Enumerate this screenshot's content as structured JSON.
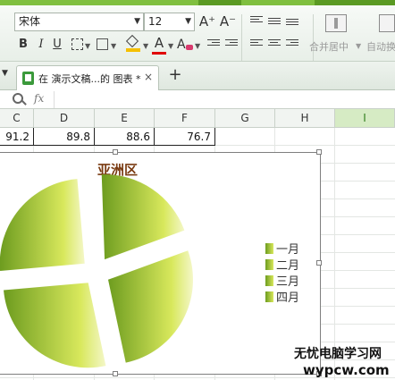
{
  "ribbon": {
    "font_name": "宋体",
    "font_size": "12",
    "bold_label": "B",
    "italic_label": "I",
    "underline_label": "U",
    "grow_font_label": "A⁺",
    "shrink_font_label": "A⁻",
    "font_color_label": "A",
    "merge_center_label": "合并居中",
    "auto_wrap_label": "自动换"
  },
  "tabs": [
    {
      "title": "在 演示文稿...的 图表 *",
      "close": "×"
    }
  ],
  "tab_add_label": "+",
  "formula_bar": {
    "fx_label": "fx",
    "value": ""
  },
  "columns": [
    {
      "label": "C",
      "selected": false
    },
    {
      "label": "D",
      "selected": false
    },
    {
      "label": "E",
      "selected": false
    },
    {
      "label": "F",
      "selected": false
    },
    {
      "label": "G",
      "selected": false
    },
    {
      "label": "H",
      "selected": false
    },
    {
      "label": "I",
      "selected": true
    }
  ],
  "row_values": [
    "91.2",
    "89.8",
    "88.6",
    "76.7"
  ],
  "chart_data": {
    "type": "pie",
    "title": "亚洲区",
    "categories": [
      "一月",
      "二月",
      "三月",
      "四月"
    ],
    "legend": [
      "一月",
      "二月",
      "三月",
      "四月"
    ],
    "legend_position": "right",
    "style": "exploded",
    "colors": {
      "dark": "#6d9c1f",
      "light": "#d8e85c"
    }
  },
  "watermark": {
    "chinese": "无忧电脑学习网",
    "url": "wypcw.com"
  }
}
